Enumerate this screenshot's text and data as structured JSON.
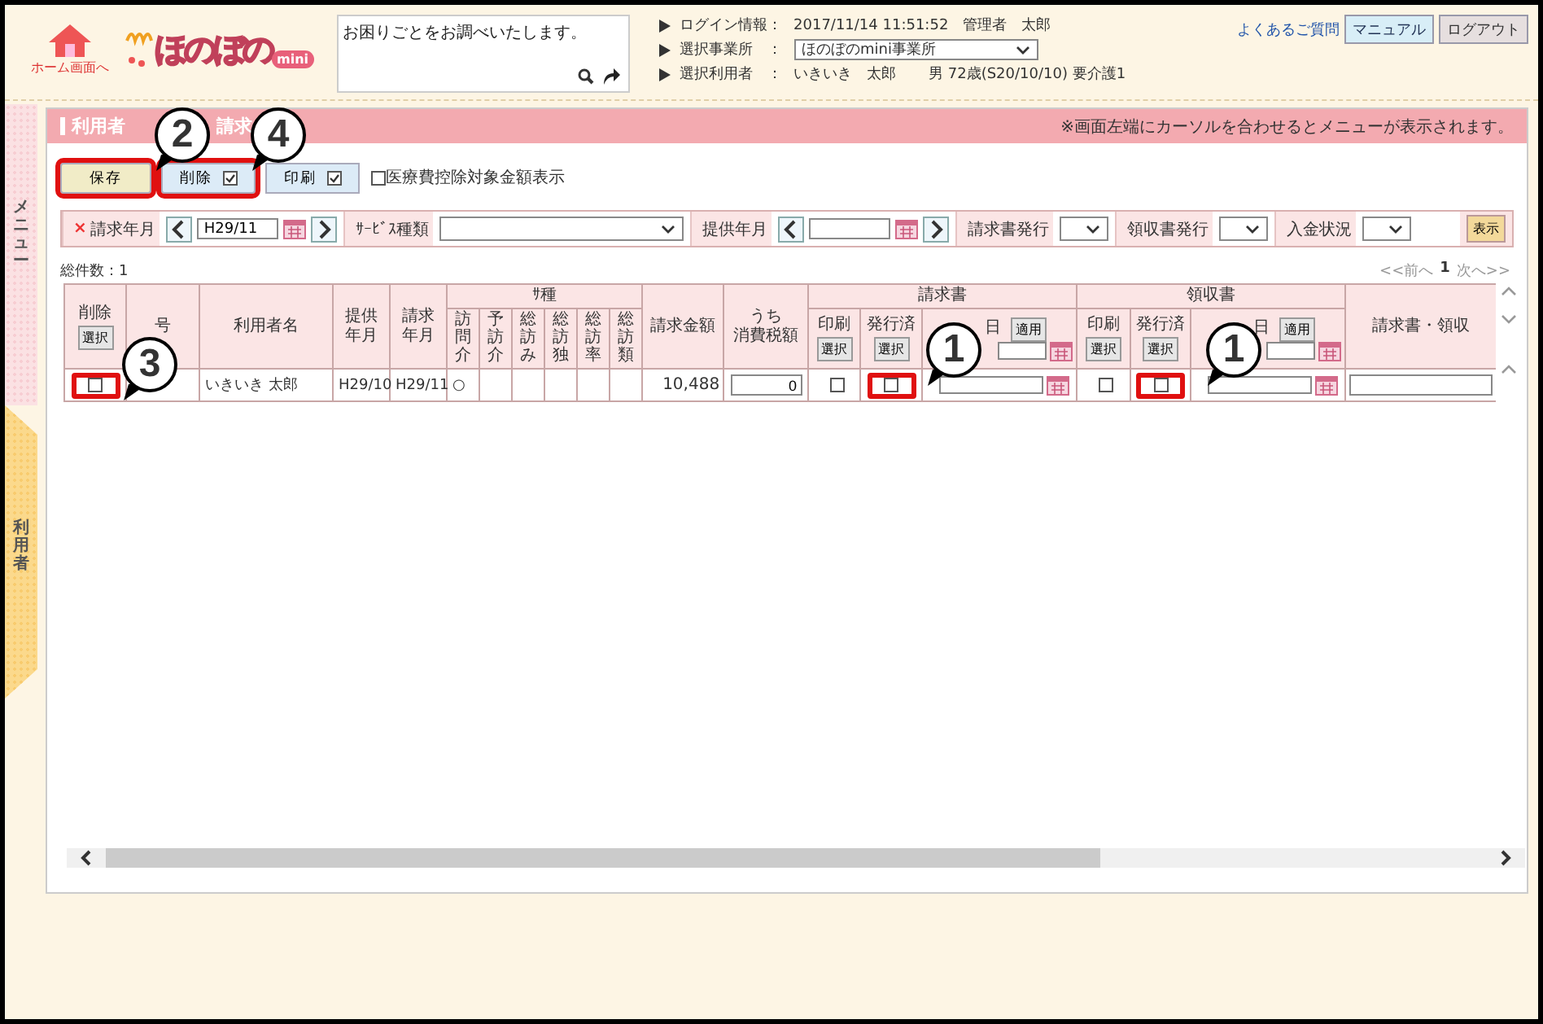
{
  "header": {
    "home_label": "ホーム画面へ",
    "logo_text": "ほのぼの",
    "logo_badge": "mini",
    "search": {
      "placeholder": "お困りごとをお調べいたします。"
    },
    "info": [
      {
        "label": "ログイン情報：",
        "kind": "text",
        "value": "2017/11/14 11:51:52　管理者　太郎"
      },
      {
        "label": "選択事業所　：",
        "kind": "select",
        "value": "ほのぼのmini事業所"
      },
      {
        "label": "選択利用者　：",
        "kind": "text",
        "value": "いきいき　太郎",
        "extra": "男 72歳(S20/10/10) 要介護1"
      }
    ],
    "links": [
      {
        "label": "よくあるご質問",
        "kind": "link"
      },
      {
        "label": "マニュアル",
        "kind": "manual"
      },
      {
        "label": "ログアウト",
        "kind": "logout"
      }
    ]
  },
  "sidebar": {
    "menu_label": "メニュー",
    "tab_label": "利用者"
  },
  "panel": {
    "title_parts": [
      "利用者",
      "請求"
    ],
    "notice": "※画面左端にカーソルを合わせるとメニューが表示されます。",
    "actions": [
      {
        "label": "保存",
        "kind": "save",
        "highlighted": true
      },
      {
        "label": "削除",
        "kind": "check",
        "checked": true,
        "highlighted": true
      },
      {
        "label": "印刷",
        "kind": "check",
        "checked": true,
        "highlighted": false
      }
    ],
    "option": {
      "label": "医療費控除対象金額表示",
      "checked": false
    },
    "filters": [
      {
        "label": "請求年月",
        "required_mark": "×",
        "kind": "month",
        "value": "H29/11"
      },
      {
        "label": "ｻｰﾋﾞｽ種類",
        "kind": "wide_select"
      },
      {
        "label": "提供年月",
        "kind": "month"
      },
      {
        "label": "請求書発行",
        "kind": "select"
      },
      {
        "label": "領収書発行",
        "kind": "select"
      },
      {
        "label": "入金状況",
        "kind": "select"
      }
    ],
    "show_button": "表示",
    "total": "総件数：1",
    "pager": {
      "prev": "<<前へ",
      "page": "1",
      "next": "次へ>>"
    },
    "table": {
      "columns": [
        {
          "lines": [
            "削除"
          ],
          "button": "選択"
        },
        {
          "lines": [
            "号"
          ]
        },
        {
          "lines": [
            "利用者名"
          ]
        },
        {
          "lines": [
            "提供",
            "年月"
          ]
        },
        {
          "lines": [
            "請求",
            "年月"
          ]
        },
        {
          "lines": [
            "ｻ種"
          ],
          "children": [
            {
              "vertical": "訪問介"
            },
            {
              "vertical": "予訪介"
            },
            {
              "vertical": "総訪み"
            },
            {
              "vertical": "総訪独"
            },
            {
              "vertical": "総訪率"
            },
            {
              "vertical": "総訪類"
            }
          ]
        },
        {
          "lines": [
            "請求金額"
          ]
        },
        {
          "lines": [
            "うち",
            "消費税額"
          ]
        },
        {
          "lines": [
            "請求書"
          ],
          "children": [
            {
              "lines": [
                "印刷"
              ],
              "button": "選択"
            },
            {
              "lines": [
                "発行済"
              ],
              "button": "選択"
            },
            {
              "lines": [
                "日"
              ],
              "button": "適用",
              "date_field": true
            }
          ]
        },
        {
          "lines": [
            "領収書"
          ],
          "children": [
            {
              "lines": [
                "印刷"
              ],
              "button": "選択"
            },
            {
              "lines": [
                "発行済"
              ],
              "button": "選択"
            },
            {
              "lines": [
                "日"
              ],
              "button": "適用",
              "date_field": true
            }
          ]
        },
        {
          "lines": [
            "請求書・領収"
          ]
        }
      ],
      "rows": [
        {
          "cells": [
            {
              "kind": "check",
              "checked": false,
              "highlighted": true
            },
            {
              "kind": "blank"
            },
            {
              "kind": "text",
              "value": "いきいき 太郎"
            },
            {
              "kind": "text",
              "value": "H29/10"
            },
            {
              "kind": "text",
              "value": "H29/11"
            },
            {
              "kind": "text",
              "value": "○"
            },
            {
              "kind": "blank"
            },
            {
              "kind": "blank"
            },
            {
              "kind": "blank"
            },
            {
              "kind": "blank"
            },
            {
              "kind": "blank"
            },
            {
              "kind": "number",
              "value": "10,488"
            },
            {
              "kind": "input",
              "value": "0"
            },
            {
              "kind": "check",
              "checked": false,
              "highlighted": false
            },
            {
              "kind": "check",
              "checked": false,
              "highlighted": true
            },
            {
              "kind": "date"
            },
            {
              "kind": "check",
              "checked": false,
              "highlighted": false
            },
            {
              "kind": "check",
              "checked": false,
              "highlighted": true
            },
            {
              "kind": "date"
            },
            {
              "kind": "input"
            }
          ]
        }
      ]
    }
  },
  "callouts": [
    {
      "number": "2"
    },
    {
      "number": "4"
    },
    {
      "number": "3"
    },
    {
      "number": "1"
    },
    {
      "number": "1"
    }
  ]
}
